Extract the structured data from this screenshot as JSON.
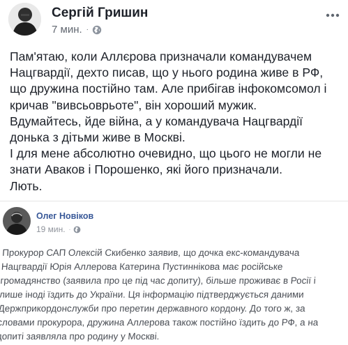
{
  "post": {
    "author": "Сергій Гришин",
    "time": "7 мин.",
    "dot": "·",
    "privacy_icon": "globe-icon",
    "more_icon": "ellipsis-icon",
    "lines": [
      "Пам'ятаю, коли Аллєрова призначали командувачем",
      "Нацгвардії, дехто писав, що у нього родина живе в РФ,",
      "що дружина постійно там. Але прибігав інфокомсомол і",
      "кричав \"вивсьоврьоте\", він хороший мужик.",
      "Вдумайтесь, йде війна, а у командувача Нацгвардії",
      "донька з дітьми живе в Москві.",
      "І для мене абсолютно очевидно, що цього не могли не",
      "знати Аваков і Порошенко, які його призначали.",
      "Лють."
    ]
  },
  "shared": {
    "author": "Олег Новіков",
    "time": "19 мин.",
    "dot": "·",
    "privacy_icon": "globe-icon",
    "lines": [
      "Прокурор САП Олексій Скибенко заявив, що дочка екс-командувача",
      "Нацгвардії Юрія Аллерова Катерина Пустиннікова має російське",
      "громадянство (заявила про це під час допиту), більше проживає в Росії і",
      "лише іноді їздить до України. Ця інформацію підтверджується даними",
      "Держприкордонслужби про перетин державного кордону. До того ж, за",
      "словами прокурора, дружина Аллерова також постійно їздить до РФ, а на",
      "допиті заявляла про родину у Москві."
    ]
  }
}
